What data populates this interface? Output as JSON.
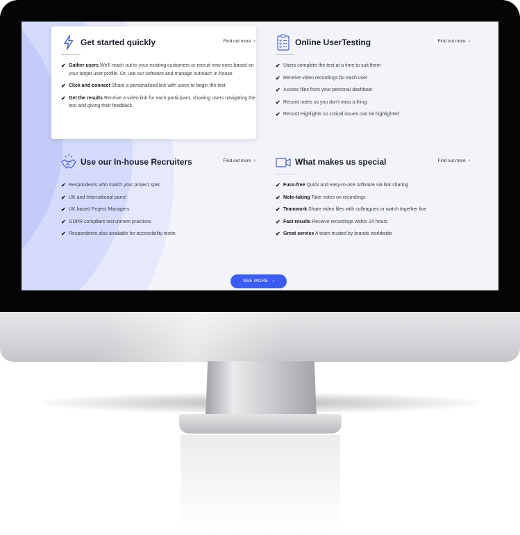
{
  "colors": {
    "accent": "#3b5cf3",
    "screen_bg": "#f3f4f9",
    "title": "#1b1f2e",
    "text": "#3c404c"
  },
  "sections": [
    {
      "icon": "lightning-icon",
      "title": "Get started quickly",
      "link": "Find out more",
      "items": [
        {
          "lead": "Gather users",
          "text": " We'll reach out to your existing customers or recruit new ones based on your target user profile. Or, use our software and manage outreach in-house"
        },
        {
          "lead": "Click and connect",
          "text": " Share a personalised link with users to begin the test"
        },
        {
          "lead": "Get the results",
          "text": " Receive a video link for each participant, showing users navigating the test and giving their feedback."
        }
      ]
    },
    {
      "icon": "clipboard-checklist-icon",
      "title": "Online UserTesting",
      "link": "Find out more",
      "items": [
        {
          "lead": "",
          "text": "Users complete the test at a time to suit them"
        },
        {
          "lead": "",
          "text": "Receive video recordings for each user"
        },
        {
          "lead": "",
          "text": "Access files from your personal dashboar"
        },
        {
          "lead": "",
          "text": "Record notes so you don't miss a thing"
        },
        {
          "lead": "",
          "text": "Record Highlights so critical issues can be highlighted"
        }
      ]
    },
    {
      "icon": "handshake-icon",
      "title": "Use our In-house Recruiters",
      "link": "Find out more",
      "items": [
        {
          "lead": "",
          "text": "Respondents who match your project spec"
        },
        {
          "lead": "",
          "text": "UK and International panel"
        },
        {
          "lead": "",
          "text": "UK based Project Managers"
        },
        {
          "lead": "",
          "text": "GDPR compliant recruitment practices"
        },
        {
          "lead": "",
          "text": "Respondents also available for accessibility testin"
        }
      ]
    },
    {
      "icon": "video-camera-icon",
      "title": "What makes us special",
      "link": "Find out more",
      "items": [
        {
          "lead": "Fuss-free",
          "text": " Quick and easy-to-use software via link sharing"
        },
        {
          "lead": "Note-taking",
          "text": " Take notes on recordings"
        },
        {
          "lead": "Teamwork",
          "text": " Share video files with colleagues or watch together live"
        },
        {
          "lead": "Fast results",
          "text": " Receive recordings within 24 hours"
        },
        {
          "lead": "Great service",
          "text": " A team trusted by brands worldwide"
        }
      ]
    }
  ],
  "cta": {
    "label": "SEE MORE"
  }
}
